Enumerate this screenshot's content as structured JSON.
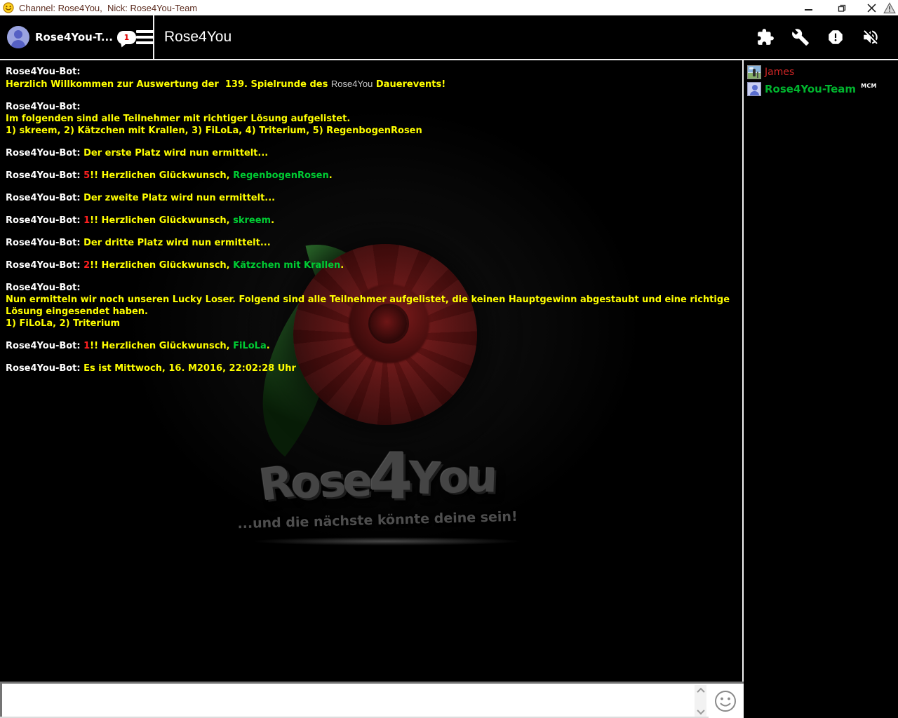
{
  "window": {
    "title": "Channel: Rose4You,  Nick: Rose4You-Team",
    "control_icons": [
      "minimize-icon",
      "restore-icon",
      "close-icon",
      "warning-icon"
    ]
  },
  "header": {
    "nick": "Rose4You-T...",
    "badge_count": "1",
    "channel_title": "Rose4You",
    "icons": [
      "plugin-icon",
      "wrench-icon",
      "alert-icon",
      "sound-muted-icon"
    ]
  },
  "colors": {
    "name": "#ffffff",
    "yellow": "#ffff00",
    "red": "#ff2020",
    "green": "#00cc33",
    "plain": "#c9c9c9"
  },
  "chat": {
    "messages": [
      [
        [
          {
            "c": "name",
            "t": "Rose4You-Bot:"
          }
        ],
        [
          {
            "c": "yellow",
            "t": "Herzlich Willkommen zur Auswertung der  139. Spielrunde des "
          },
          {
            "c": "plain",
            "t": "Rose4You"
          },
          {
            "c": "yellow",
            "t": " Dauerevents!"
          }
        ]
      ],
      [
        [
          {
            "c": "name",
            "t": "Rose4You-Bot:"
          }
        ],
        [
          {
            "c": "yellow",
            "t": "Im folgenden sind alle Teilnehmer mit richtiger Lösung aufgelistet."
          }
        ],
        [
          {
            "c": "yellow",
            "t": "1) skreem, 2) Kätzchen mit Krallen, 3) FiLoLa, 4) Triterium, 5) RegenbogenRosen"
          }
        ]
      ],
      [
        [
          {
            "c": "name",
            "t": "Rose4You-Bot: "
          },
          {
            "c": "yellow",
            "t": "Der erste Platz wird nun ermittelt..."
          }
        ]
      ],
      [
        [
          {
            "c": "name",
            "t": "Rose4You-Bot: "
          },
          {
            "c": "red",
            "t": "5"
          },
          {
            "c": "yellow",
            "t": "!! Herzlichen Glückwunsch, "
          },
          {
            "c": "green",
            "t": "RegenbogenRosen"
          },
          {
            "c": "yellow",
            "t": "."
          }
        ]
      ],
      [
        [
          {
            "c": "name",
            "t": "Rose4You-Bot: "
          },
          {
            "c": "yellow",
            "t": "Der zweite Platz wird nun ermittelt..."
          }
        ]
      ],
      [
        [
          {
            "c": "name",
            "t": "Rose4You-Bot: "
          },
          {
            "c": "red",
            "t": "1"
          },
          {
            "c": "yellow",
            "t": "!! Herzlichen Glückwunsch, "
          },
          {
            "c": "green",
            "t": "skreem"
          },
          {
            "c": "yellow",
            "t": "."
          }
        ]
      ],
      [
        [
          {
            "c": "name",
            "t": "Rose4You-Bot: "
          },
          {
            "c": "yellow",
            "t": "Der dritte Platz wird nun ermittelt..."
          }
        ]
      ],
      [
        [
          {
            "c": "name",
            "t": "Rose4You-Bot: "
          },
          {
            "c": "red",
            "t": "2"
          },
          {
            "c": "yellow",
            "t": "!! Herzlichen Glückwunsch, "
          },
          {
            "c": "green",
            "t": "Kätzchen mit Krallen"
          },
          {
            "c": "yellow",
            "t": "."
          }
        ]
      ],
      [
        [
          {
            "c": "name",
            "t": "Rose4You-Bot:"
          }
        ],
        [
          {
            "c": "yellow",
            "t": "Nun ermitteln wir noch unseren Lucky Loser. Folgend sind alle Teilnehmer aufgelistet, die keinen Hauptgewinn abgestaubt und eine richtige Lösung eingesendet haben."
          }
        ],
        [
          {
            "c": "yellow",
            "t": "1) FiLoLa, 2) Triterium"
          }
        ]
      ],
      [
        [
          {
            "c": "name",
            "t": "Rose4You-Bot: "
          },
          {
            "c": "red",
            "t": "1"
          },
          {
            "c": "yellow",
            "t": "!! Herzlichen Glückwunsch, "
          },
          {
            "c": "green",
            "t": "FiLoLa"
          },
          {
            "c": "yellow",
            "t": "."
          }
        ]
      ],
      [
        [
          {
            "c": "name",
            "t": "Rose4You-Bot: "
          },
          {
            "c": "yellow",
            "t": "Es ist Mittwoch, 16. M2016, 22:02:28 Uhr"
          }
        ]
      ]
    ]
  },
  "watermark": {
    "logo": "Rose4You",
    "tagline": "...und die nächste könnte deine sein!"
  },
  "userlist": {
    "users": [
      {
        "name": "James",
        "color": "#cf2525",
        "bold": false,
        "avatar": "photo-avatar",
        "badge": ""
      },
      {
        "name": "Rose4You-Team",
        "color": "#00b42e",
        "bold": true,
        "avatar": "person-avatar",
        "badge": "MCM"
      }
    ]
  },
  "input": {
    "value": "",
    "placeholder": ""
  }
}
